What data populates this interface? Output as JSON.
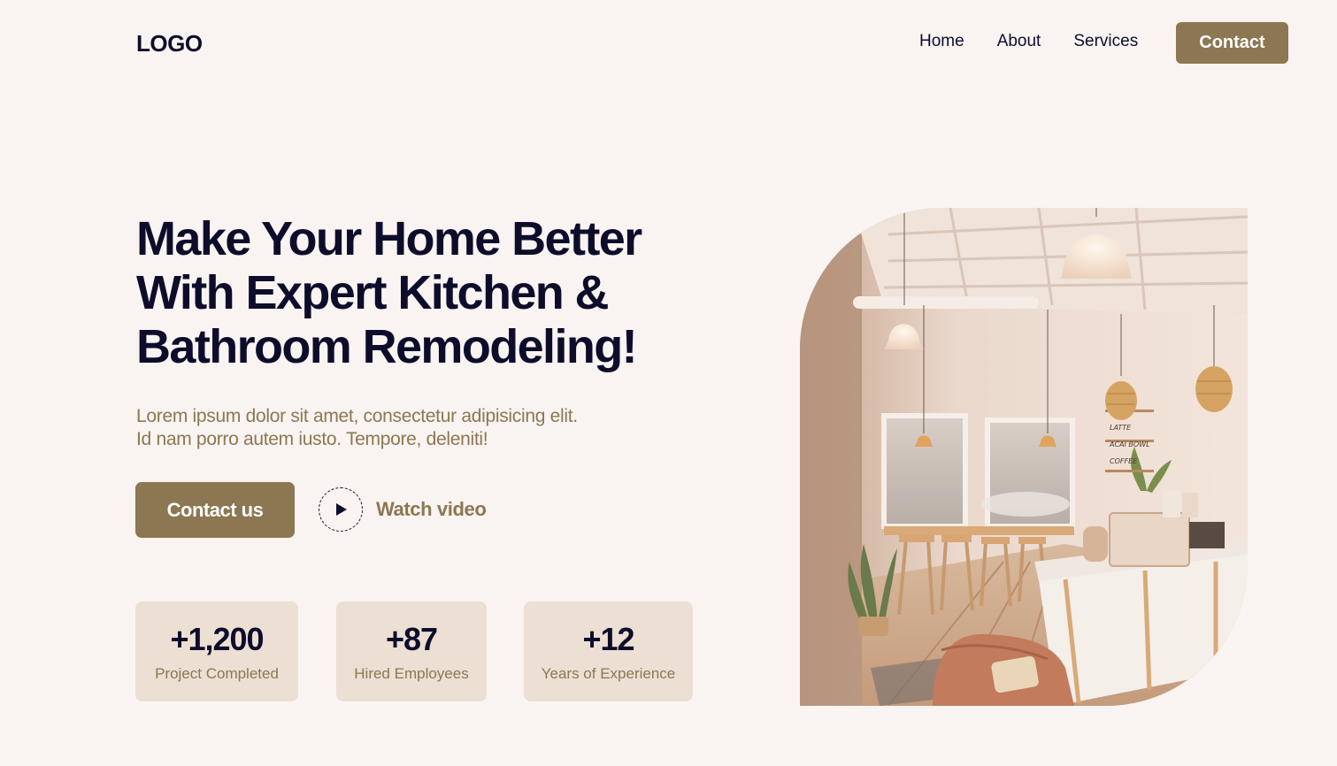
{
  "header": {
    "logo": "LOGO",
    "nav": [
      {
        "label": "Home"
      },
      {
        "label": "About"
      },
      {
        "label": "Services"
      }
    ],
    "contact_label": "Contact"
  },
  "hero": {
    "title_lines": [
      "Make Your Home Better",
      "With Expert Kitchen &",
      "Bathroom Remodeling!"
    ],
    "subtitle_lines": [
      "Lorem ipsum dolor sit amet, consectetur adipisicing elit.",
      "Id nam porro autem iusto. Tempore, deleniti!"
    ],
    "cta_label": "Contact us",
    "video_label": "Watch video"
  },
  "stats": [
    {
      "value": "+1,200",
      "label": "Project Completed"
    },
    {
      "value": "+87",
      "label": "Hired Employees"
    },
    {
      "value": "+12",
      "label": "Years of Experience"
    }
  ],
  "image": {
    "menu_board": [
      "LATTE",
      "ACAI BOWL",
      "COFFEE"
    ]
  },
  "colors": {
    "background": "#f9f4f1",
    "accent": "#8c7752",
    "heading": "#0d0d2b",
    "stat_card": "#ecdfd3"
  }
}
